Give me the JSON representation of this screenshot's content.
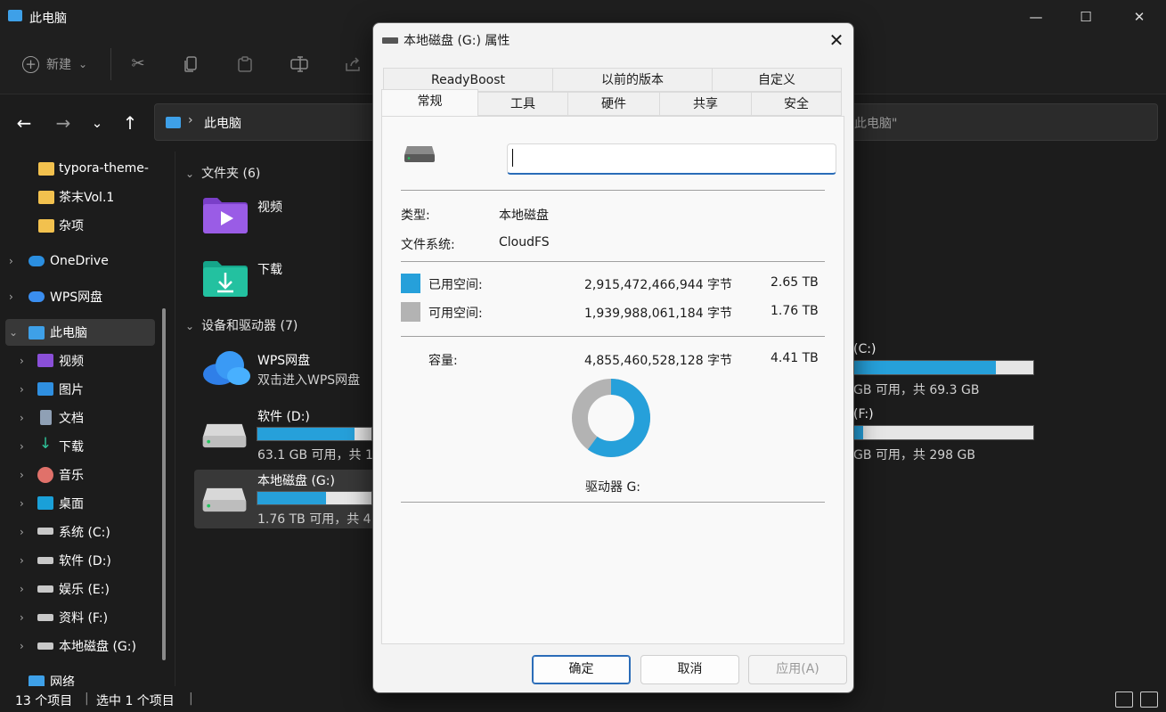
{
  "window": {
    "title": "此电脑",
    "minimize": "—",
    "maximize": "☐",
    "close": "✕"
  },
  "toolbar": {
    "new_label": "新建",
    "new_chevron": "⌄",
    "icons": [
      "cut-icon",
      "copy-icon",
      "paste-icon",
      "rename-icon",
      "share-icon"
    ]
  },
  "nav": {
    "back": "←",
    "forward": "→",
    "recent": "⌄",
    "up": "↑",
    "breadcrumb_sep": "›",
    "breadcrumb": "此电脑",
    "search_placeholder": "此电脑\""
  },
  "sidebar": {
    "items": [
      {
        "label": "typora-theme-",
        "icon": "folder-icon"
      },
      {
        "label": "茶末Vol.1",
        "icon": "folder-icon"
      },
      {
        "label": "杂项",
        "icon": "folder-icon"
      },
      {
        "label": "OneDrive",
        "icon": "onedrive-icon"
      },
      {
        "label": "WPS网盘",
        "icon": "wps-cloud-icon"
      },
      {
        "label": "此电脑",
        "icon": "pc-icon"
      },
      {
        "label": "视频",
        "icon": "video-icon"
      },
      {
        "label": "图片",
        "icon": "pictures-icon"
      },
      {
        "label": "文档",
        "icon": "documents-icon"
      },
      {
        "label": "下载",
        "icon": "download-icon"
      },
      {
        "label": "音乐",
        "icon": "music-icon"
      },
      {
        "label": "桌面",
        "icon": "desktop-icon"
      },
      {
        "label": "系统 (C:)",
        "icon": "system-drive-icon"
      },
      {
        "label": "软件 (D:)",
        "icon": "drive-icon"
      },
      {
        "label": "娱乐 (E:)",
        "icon": "drive-icon"
      },
      {
        "label": "资料 (F:)",
        "icon": "drive-icon"
      },
      {
        "label": "本地磁盘 (G:)",
        "icon": "drive-icon"
      },
      {
        "label": "网络",
        "icon": "network-icon"
      }
    ]
  },
  "content": {
    "folders_header": "文件夹 (6)",
    "folders": [
      {
        "label": "视频"
      },
      {
        "label": "下载"
      }
    ],
    "drives_header": "设备和驱动器 (7)",
    "wps": {
      "label": "WPS网盘",
      "sub": "双击进入WPS网盘"
    },
    "drive_d": {
      "label": "软件 (D:)",
      "sub": "63.1 GB 可用，共 1",
      "fill": 0.85
    },
    "drive_g": {
      "label": "本地磁盘 (G:)",
      "sub": "1.76 TB 可用，共 4",
      "fill": 0.6
    },
    "drive_c": {
      "label": "(C:)",
      "sub": "GB 可用，共 69.3 GB",
      "fill": 0.79
    },
    "drive_f": {
      "label": "(F:)",
      "sub": "GB 可用，共 298 GB",
      "fill": 0.05
    }
  },
  "status": {
    "count": "13 个项目",
    "selected": "选中 1 个项目"
  },
  "dialog": {
    "title": "本地磁盘 (G:) 属性",
    "close": "✕",
    "tabs_row1": [
      "ReadyBoost",
      "以前的版本",
      "自定义"
    ],
    "tabs_row2": [
      "常规",
      "工具",
      "硬件",
      "共享",
      "安全"
    ],
    "active_tab": "常规",
    "name_value": "",
    "type_label": "类型:",
    "type_value": "本地磁盘",
    "fs_label": "文件系统:",
    "fs_value": "CloudFS",
    "used_label": "已用空间:",
    "used_bytes": "2,915,472,466,944 字节",
    "used_size": "2.65 TB",
    "free_label": "可用空间:",
    "free_bytes": "1,939,988,061,184 字节",
    "free_size": "1.76 TB",
    "cap_label": "容量:",
    "cap_bytes": "4,855,460,528,128 字节",
    "cap_size": "4.41 TB",
    "used_fraction": 0.6,
    "used_color": "#26a0da",
    "free_color": "#b3b3b3",
    "drive_caption": "驱动器 G:",
    "ok": "确定",
    "cancel": "取消",
    "apply": "应用(A)"
  }
}
